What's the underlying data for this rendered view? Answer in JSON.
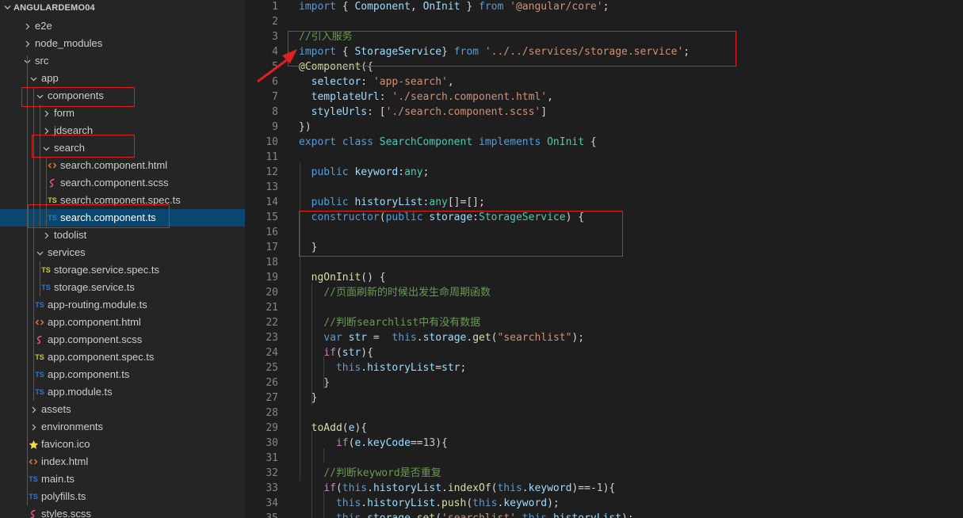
{
  "explorer": {
    "title": "ANGULARDEMO04",
    "items": [
      {
        "label": "e2e",
        "icon": "chevron-right-icon"
      },
      {
        "label": "node_modules",
        "icon": "chevron-right-icon"
      },
      {
        "label": "src",
        "icon": "chevron-down-icon"
      },
      {
        "label": "app",
        "icon": "chevron-down-icon"
      },
      {
        "label": "components",
        "icon": "chevron-down-icon"
      },
      {
        "label": "form",
        "icon": "chevron-right-icon"
      },
      {
        "label": "jdsearch",
        "icon": "chevron-right-icon"
      },
      {
        "label": "search",
        "icon": "chevron-down-icon"
      },
      {
        "label": "search.component.html",
        "icon": "html-file-icon"
      },
      {
        "label": "search.component.scss",
        "icon": "scss-file-icon"
      },
      {
        "label": "search.component.spec.ts",
        "icon": "ts-spec-file-icon"
      },
      {
        "label": "search.component.ts",
        "icon": "ts-file-icon"
      },
      {
        "label": "todolist",
        "icon": "chevron-right-icon"
      },
      {
        "label": "services",
        "icon": "chevron-down-icon"
      },
      {
        "label": "storage.service.spec.ts",
        "icon": "ts-spec-file-icon"
      },
      {
        "label": "storage.service.ts",
        "icon": "ts-file-icon"
      },
      {
        "label": "app-routing.module.ts",
        "icon": "ts-file-icon"
      },
      {
        "label": "app.component.html",
        "icon": "html-file-icon"
      },
      {
        "label": "app.component.scss",
        "icon": "scss-file-icon"
      },
      {
        "label": "app.component.spec.ts",
        "icon": "ts-spec-file-icon"
      },
      {
        "label": "app.component.ts",
        "icon": "ts-file-icon"
      },
      {
        "label": "app.module.ts",
        "icon": "ts-file-icon"
      },
      {
        "label": "assets",
        "icon": "chevron-right-icon"
      },
      {
        "label": "environments",
        "icon": "chevron-right-icon"
      },
      {
        "label": "favicon.ico",
        "icon": "star-icon"
      },
      {
        "label": "index.html",
        "icon": "html-file-icon"
      },
      {
        "label": "main.ts",
        "icon": "ts-file-icon"
      },
      {
        "label": "polyfills.ts",
        "icon": "ts-file-icon"
      },
      {
        "label": "styles.scss",
        "icon": "scss-file-icon"
      }
    ],
    "selected": "search.component.ts",
    "ts_badge": "TS"
  },
  "editor": {
    "lines": [
      {
        "n": "1",
        "t": [
          [
            "k",
            "import"
          ],
          [
            "p",
            " { "
          ],
          [
            "v",
            "Component"
          ],
          [
            "p",
            ", "
          ],
          [
            "v",
            "OnInit"
          ],
          [
            "p",
            " } "
          ],
          [
            "k",
            "from"
          ],
          [
            "p",
            " "
          ],
          [
            "s",
            "'@angular/core'"
          ],
          [
            "p",
            ";"
          ]
        ]
      },
      {
        "n": "2",
        "t": []
      },
      {
        "n": "3",
        "t": [
          [
            "c",
            "//引入服务"
          ]
        ]
      },
      {
        "n": "4",
        "t": [
          [
            "k",
            "import"
          ],
          [
            "p",
            " { "
          ],
          [
            "v",
            "StorageService"
          ],
          [
            "p",
            "} "
          ],
          [
            "k",
            "from"
          ],
          [
            "p",
            " "
          ],
          [
            "s",
            "'../../services/storage.service'"
          ],
          [
            "p",
            ";"
          ]
        ]
      },
      {
        "n": "5",
        "t": [
          [
            "f",
            "@Component"
          ],
          [
            "p",
            "({"
          ]
        ]
      },
      {
        "n": "6",
        "t": [
          [
            "p",
            "  "
          ],
          [
            "v",
            "selector"
          ],
          [
            "p",
            ": "
          ],
          [
            "s",
            "'app-search'"
          ],
          [
            "p",
            ","
          ]
        ]
      },
      {
        "n": "7",
        "t": [
          [
            "p",
            "  "
          ],
          [
            "v",
            "templateUrl"
          ],
          [
            "p",
            ": "
          ],
          [
            "s",
            "'./search.component.html'"
          ],
          [
            "p",
            ","
          ]
        ]
      },
      {
        "n": "8",
        "t": [
          [
            "p",
            "  "
          ],
          [
            "v",
            "styleUrls"
          ],
          [
            "p",
            ": ["
          ],
          [
            "s",
            "'./search.component.scss'"
          ],
          [
            "p",
            "]"
          ]
        ]
      },
      {
        "n": "9",
        "t": [
          [
            "p",
            "})"
          ]
        ]
      },
      {
        "n": "10",
        "t": [
          [
            "k",
            "export"
          ],
          [
            "p",
            " "
          ],
          [
            "k",
            "class"
          ],
          [
            "p",
            " "
          ],
          [
            "t",
            "SearchComponent"
          ],
          [
            "p",
            " "
          ],
          [
            "k",
            "implements"
          ],
          [
            "p",
            " "
          ],
          [
            "t",
            "OnInit"
          ],
          [
            "p",
            " {"
          ]
        ]
      },
      {
        "n": "11",
        "t": []
      },
      {
        "n": "12",
        "t": [
          [
            "p",
            "  "
          ],
          [
            "k",
            "public"
          ],
          [
            "p",
            " "
          ],
          [
            "v",
            "keyword"
          ],
          [
            "p",
            ":"
          ],
          [
            "t",
            "any"
          ],
          [
            "p",
            ";"
          ]
        ]
      },
      {
        "n": "13",
        "t": []
      },
      {
        "n": "14",
        "t": [
          [
            "p",
            "  "
          ],
          [
            "k",
            "public"
          ],
          [
            "p",
            " "
          ],
          [
            "v",
            "historyList"
          ],
          [
            "p",
            ":"
          ],
          [
            "t",
            "any"
          ],
          [
            "p",
            "[]=[];"
          ]
        ]
      },
      {
        "n": "15",
        "t": [
          [
            "p",
            "  "
          ],
          [
            "k",
            "constructor"
          ],
          [
            "p",
            "("
          ],
          [
            "k",
            "public"
          ],
          [
            "p",
            " "
          ],
          [
            "v",
            "storage"
          ],
          [
            "p",
            ":"
          ],
          [
            "t",
            "StorageService"
          ],
          [
            "p",
            ") {"
          ]
        ]
      },
      {
        "n": "16",
        "t": []
      },
      {
        "n": "17",
        "t": [
          [
            "p",
            "  }"
          ]
        ]
      },
      {
        "n": "18",
        "t": []
      },
      {
        "n": "19",
        "t": [
          [
            "p",
            "  "
          ],
          [
            "f",
            "ngOnInit"
          ],
          [
            "p",
            "() {"
          ]
        ]
      },
      {
        "n": "20",
        "t": [
          [
            "p",
            "    "
          ],
          [
            "c",
            "//页面刷新的时候出发生命周期函数"
          ]
        ]
      },
      {
        "n": "21",
        "t": []
      },
      {
        "n": "22",
        "t": [
          [
            "p",
            "    "
          ],
          [
            "c",
            "//判断searchlist中有没有数据"
          ]
        ]
      },
      {
        "n": "23",
        "t": [
          [
            "p",
            "    "
          ],
          [
            "k",
            "var"
          ],
          [
            "p",
            " "
          ],
          [
            "v",
            "str"
          ],
          [
            "p",
            " =  "
          ],
          [
            "k",
            "this"
          ],
          [
            "p",
            "."
          ],
          [
            "v",
            "storage"
          ],
          [
            "p",
            "."
          ],
          [
            "f",
            "get"
          ],
          [
            "p",
            "("
          ],
          [
            "s",
            "\"searchlist\""
          ],
          [
            "p",
            ");"
          ]
        ]
      },
      {
        "n": "24",
        "t": [
          [
            "p",
            "    "
          ],
          [
            "ctl",
            "if"
          ],
          [
            "p",
            "("
          ],
          [
            "v",
            "str"
          ],
          [
            "p",
            "){"
          ]
        ]
      },
      {
        "n": "25",
        "t": [
          [
            "p",
            "      "
          ],
          [
            "k",
            "this"
          ],
          [
            "p",
            "."
          ],
          [
            "v",
            "historyList"
          ],
          [
            "p",
            "="
          ],
          [
            "v",
            "str"
          ],
          [
            "p",
            ";"
          ]
        ]
      },
      {
        "n": "26",
        "t": [
          [
            "p",
            "    }"
          ]
        ]
      },
      {
        "n": "27",
        "t": [
          [
            "p",
            "  }"
          ]
        ]
      },
      {
        "n": "28",
        "t": []
      },
      {
        "n": "29",
        "t": [
          [
            "p",
            "  "
          ],
          [
            "f",
            "toAdd"
          ],
          [
            "p",
            "("
          ],
          [
            "v",
            "e"
          ],
          [
            "p",
            "){"
          ]
        ]
      },
      {
        "n": "30",
        "t": [
          [
            "p",
            "      "
          ],
          [
            "ctl",
            "if"
          ],
          [
            "p",
            "("
          ],
          [
            "v",
            "e"
          ],
          [
            "p",
            "."
          ],
          [
            "v",
            "keyCode"
          ],
          [
            "p",
            "=="
          ],
          [
            "n",
            "13"
          ],
          [
            "p",
            "){"
          ]
        ]
      },
      {
        "n": "31",
        "t": []
      },
      {
        "n": "32",
        "t": [
          [
            "p",
            "    "
          ],
          [
            "c",
            "//判断keyword是否重复"
          ]
        ]
      },
      {
        "n": "33",
        "t": [
          [
            "p",
            "    "
          ],
          [
            "ctl",
            "if"
          ],
          [
            "p",
            "("
          ],
          [
            "k",
            "this"
          ],
          [
            "p",
            "."
          ],
          [
            "v",
            "historyList"
          ],
          [
            "p",
            "."
          ],
          [
            "f",
            "indexOf"
          ],
          [
            "p",
            "("
          ],
          [
            "k",
            "this"
          ],
          [
            "p",
            "."
          ],
          [
            "v",
            "keyword"
          ],
          [
            "p",
            ")==-"
          ],
          [
            "n",
            "1"
          ],
          [
            "p",
            "){"
          ]
        ]
      },
      {
        "n": "34",
        "t": [
          [
            "p",
            "      "
          ],
          [
            "k",
            "this"
          ],
          [
            "p",
            "."
          ],
          [
            "v",
            "historyList"
          ],
          [
            "p",
            "."
          ],
          [
            "f",
            "push"
          ],
          [
            "p",
            "("
          ],
          [
            "k",
            "this"
          ],
          [
            "p",
            "."
          ],
          [
            "v",
            "keyword"
          ],
          [
            "p",
            ");"
          ]
        ]
      },
      {
        "n": "35",
        "t": [
          [
            "p",
            "      "
          ],
          [
            "k",
            "this"
          ],
          [
            "p",
            "."
          ],
          [
            "v",
            "storage"
          ],
          [
            "p",
            "."
          ],
          [
            "f",
            "set"
          ],
          [
            "p",
            "("
          ],
          [
            "s",
            "'searchlist'"
          ],
          [
            "p",
            ","
          ],
          [
            "k",
            "this"
          ],
          [
            "p",
            "."
          ],
          [
            "v",
            "historyList"
          ],
          [
            "p",
            ");"
          ]
        ]
      }
    ]
  },
  "colors": {
    "annotation": "#e02020",
    "ts_badge": "#3178c6",
    "ts_spec_badge": "#cbcb41",
    "html_icon": "#e37933",
    "scss_icon": "#f55385",
    "star": "#f9d94a"
  }
}
